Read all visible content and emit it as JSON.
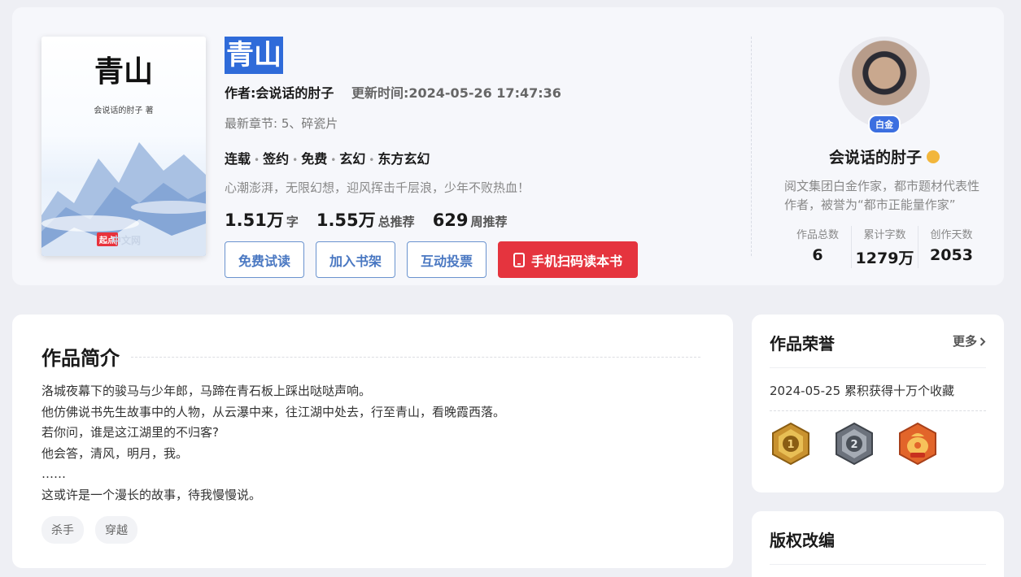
{
  "book": {
    "cover_title": "青山",
    "cover_author": "会说话的肘子 著",
    "cover_logo": "起点",
    "cover_logo_text": "中文网",
    "title": "青山",
    "author_label": "作者:会说话的肘子",
    "update_label": "更新时间:2024-05-26 17:47:36",
    "latest_chapter": "最新章节: 5、碎瓷片",
    "tags": [
      "连载",
      "签约",
      "免费",
      "玄幻",
      "东方玄幻"
    ],
    "slogan": "心潮澎湃，无限幻想，迎风挥击千层浪，少年不败热血！",
    "stats": [
      {
        "value": "1.51万",
        "unit": "字"
      },
      {
        "value": "1.55万",
        "unit": "总推荐"
      },
      {
        "value": "629",
        "unit": "周推荐"
      }
    ],
    "buttons": {
      "free_read": "免费试读",
      "add_shelf": "加入书架",
      "vote": "互动投票",
      "scan_read": "手机扫码读本书"
    }
  },
  "author": {
    "badge": "白金",
    "name": "会说话的肘子",
    "desc": "阅文集团白金作家，都市题材代表性作者，被誉为“都市正能量作家”",
    "stats": [
      {
        "label": "作品总数",
        "value": "6"
      },
      {
        "label": "累计字数",
        "value": "1279万"
      },
      {
        "label": "创作天数",
        "value": "2053"
      }
    ]
  },
  "intro": {
    "title": "作品简介",
    "lines": [
      "洛城夜幕下的骏马与少年郎，马蹄在青石板上踩出哒哒声响。",
      "他仿佛说书先生故事中的人物，从云瀑中来，往江湖中处去，行至青山，看晚霞西落。",
      "若你问，谁是这江湖里的不归客?",
      "他会答，清风，明月，我。",
      "……",
      "这或许是一个漫长的故事，待我慢慢说。"
    ],
    "tags": [
      "杀手",
      "穿越"
    ]
  },
  "honors": {
    "title": "作品荣誉",
    "more": "更多",
    "record": "2024-05-25 累积获得十万个收藏",
    "medals": [
      "gold-medal-1-icon",
      "silver-medal-2-icon",
      "fortune-bag-medal-icon"
    ],
    "medal_numbers": [
      "1",
      "2"
    ]
  },
  "copyright": {
    "title": "版权改编"
  },
  "colors": {
    "accent_blue": "#2f6bd9",
    "button_border": "#6a93cf",
    "primary_red": "#e5343e",
    "page_bg": "#eeeff4"
  }
}
